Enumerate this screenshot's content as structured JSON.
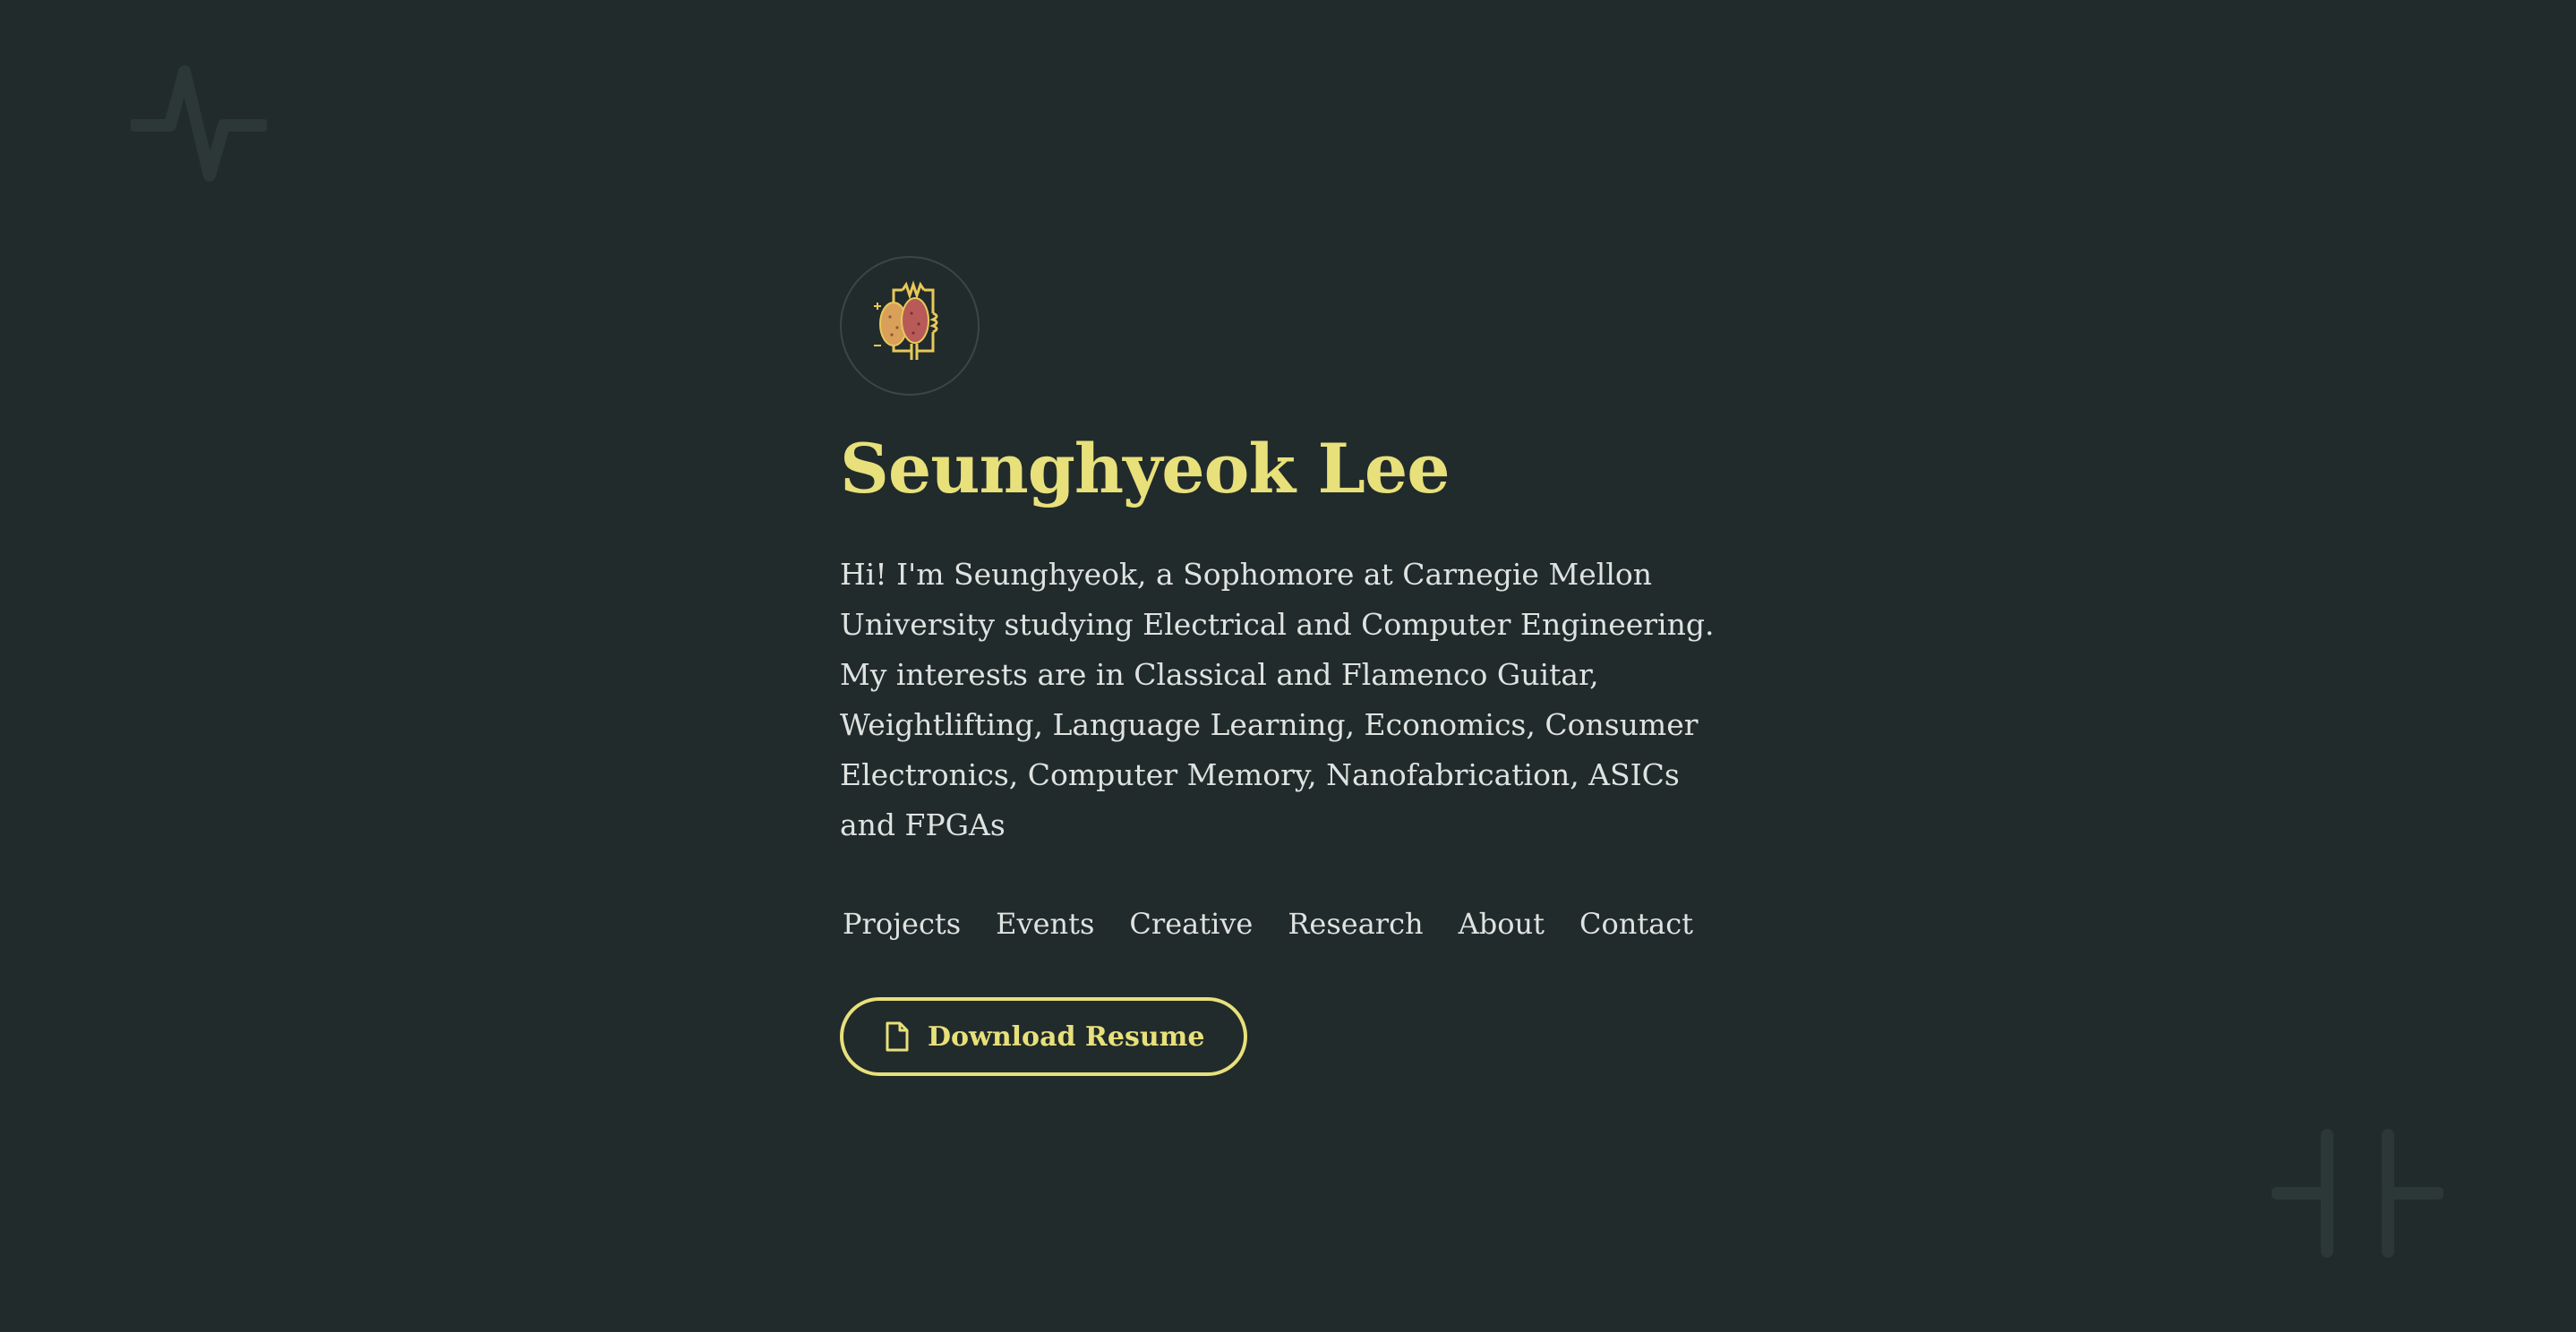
{
  "hero": {
    "name": "Seunghyeok Lee",
    "intro": "Hi! I'm Seunghyeok, a Sophomore at Carnegie Mellon University studying Electrical and Computer Engineering. My interests are in Classical and Flamenco Guitar, Weightlifting, Language Learning, Economics, Consumer Electronics, Computer Memory, Nanofabrication, ASICs and FPGAs"
  },
  "nav": {
    "items": [
      {
        "label": "Projects"
      },
      {
        "label": "Events"
      },
      {
        "label": "Creative"
      },
      {
        "label": "Research"
      },
      {
        "label": "About"
      },
      {
        "label": "Contact"
      }
    ]
  },
  "resume_button": {
    "label": "Download Resume",
    "icon": "document-icon"
  },
  "decorations": {
    "top_left": "pulse-waveform-icon",
    "bottom_right": "capacitor-icon"
  },
  "avatar": {
    "icon": "potato-circuit-logo"
  },
  "colors": {
    "background": "#212b2c",
    "accent": "#e8e07a",
    "text": "#dfe3e0",
    "decoration": "#2c3737"
  }
}
